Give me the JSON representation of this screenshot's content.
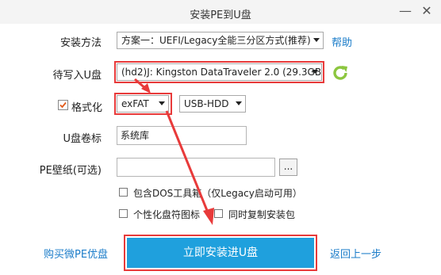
{
  "window": {
    "title": "安装PE到U盘",
    "minimize_glyph": "—",
    "close_glyph": "✕"
  },
  "form": {
    "install_method": {
      "label": "安装方法",
      "value": "方案一：UEFI/Legacy全能三分区方式(推荐)"
    },
    "help_link": "帮助",
    "target_drive": {
      "label": "待写入U盘",
      "value": "(hd2)J: Kingston DataTraveler 2.0 (29.3GB"
    },
    "format": {
      "label": "格式化",
      "checked": true,
      "filesystem": "exFAT",
      "mode": "USB-HDD"
    },
    "volume_label": {
      "label": "U盘卷标",
      "value": "系统库"
    },
    "wallpaper": {
      "label": "PE壁纸(可选)",
      "value": "",
      "browse_label": "..."
    }
  },
  "options": {
    "include_dos": "包含DOS工具箱（仅Legacy启动可用）",
    "personalize_icon": "个性化盘符图标",
    "copy_installer": "同时复制安装包"
  },
  "footer": {
    "buy_link": "购买微PE优盘",
    "install_button": "立即安装进U盘",
    "back_link": "返回上一步"
  },
  "colors": {
    "accent": "#1fa0dd",
    "link": "#1a7cc9",
    "annotation": "#e83a3a",
    "refresh": "#8cc63f"
  }
}
